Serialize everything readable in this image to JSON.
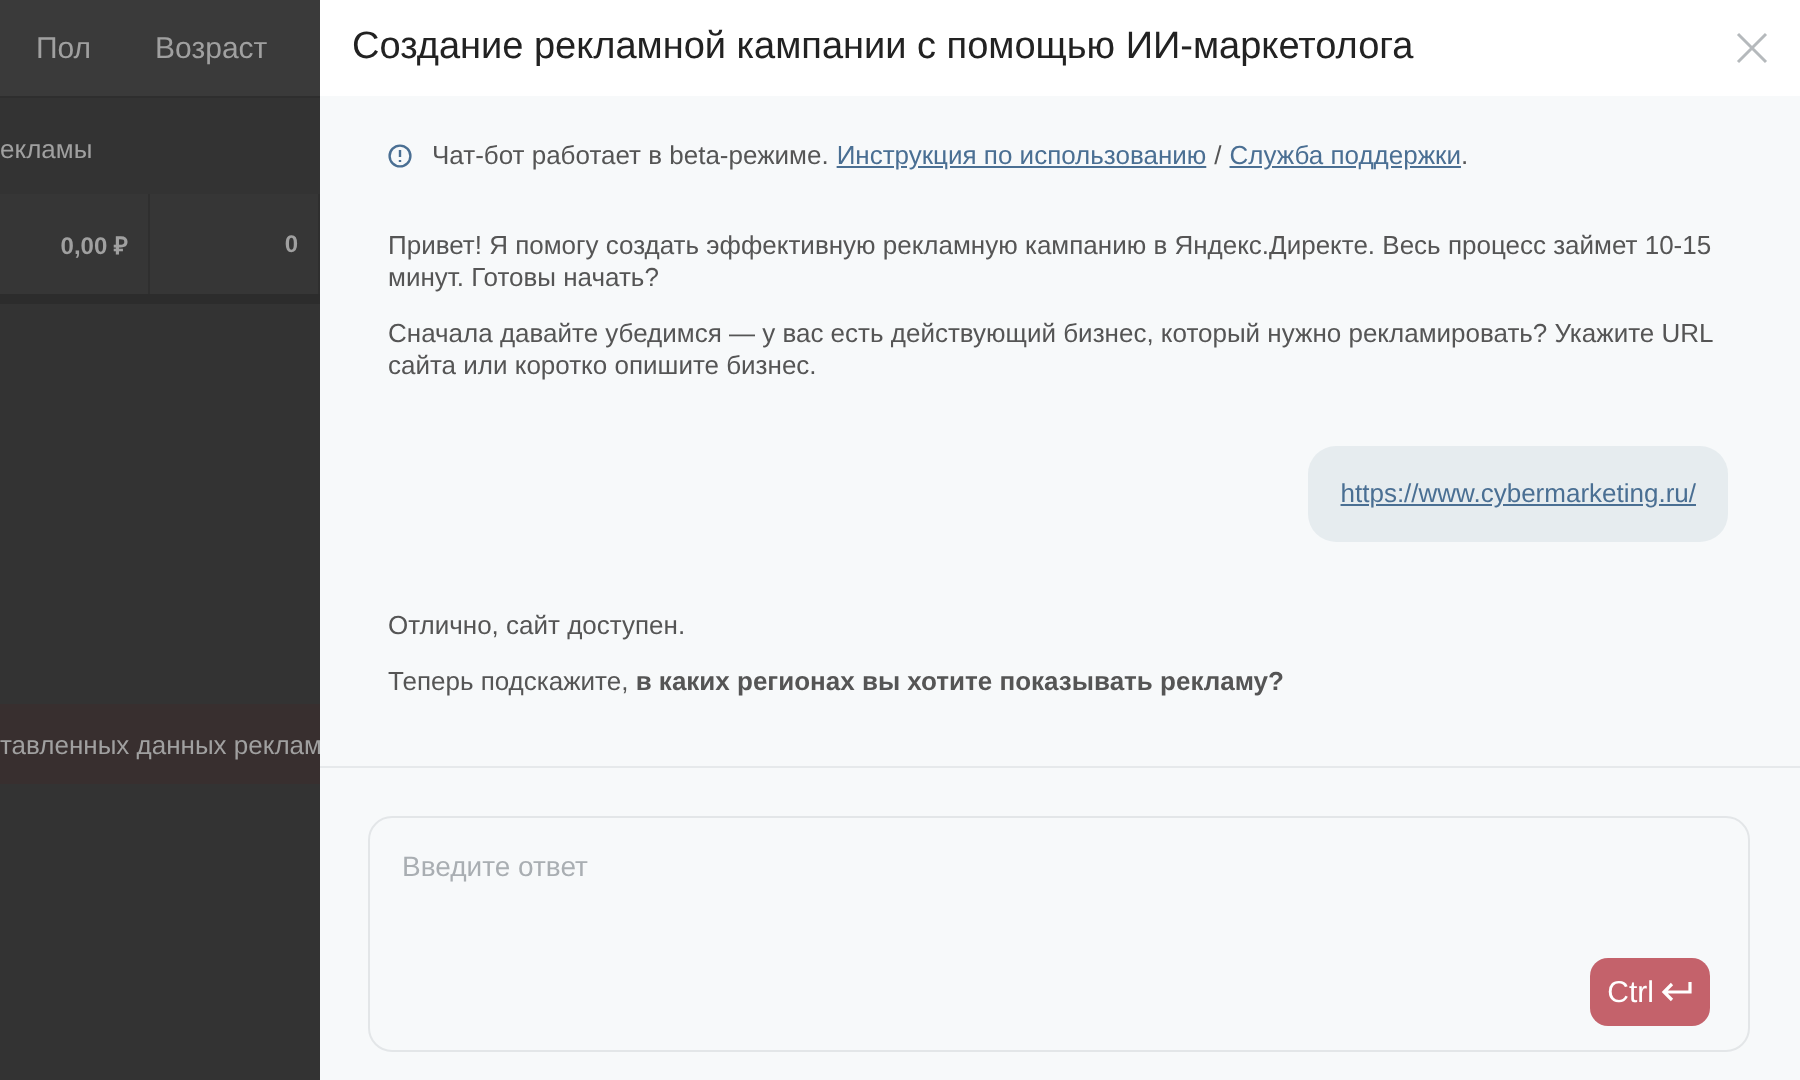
{
  "background": {
    "columns": [
      "Пол",
      "Возраст"
    ],
    "section_label": "екламы",
    "cells": [
      "0,00 ₽",
      "0"
    ],
    "notice": "тавленных данных реклам"
  },
  "modal": {
    "title": "Создание рекламной кампании с помощью ИИ-маркетолога",
    "beta_notice": {
      "text": "Чат-бот работает в beta-режиме.",
      "links": [
        "Инструкция по использованию",
        "Служба поддержки"
      ],
      "separator": "/",
      "end": "."
    },
    "messages": [
      {
        "kind": "bot",
        "paragraphs": [
          "Привет! Я помогу создать эффективную рекламную кампанию в Яндекс.Директе. Весь процесс займет 10-15 минут. Готовы начать?",
          "Сначала давайте убедимся — у вас есть действующий бизнес, который нужно рекламировать? Укажите URL сайта или коротко опишите бизнес."
        ]
      },
      {
        "kind": "user",
        "link": "https://www.cybermarketing.ru/"
      },
      {
        "kind": "bot",
        "paragraphs": [
          "Отлично, сайт доступен.",
          "Теперь подскажите, **в каких регионах вы хотите показывать рекламу?**"
        ]
      }
    ],
    "input": {
      "placeholder": "Введите ответ"
    },
    "send_button": {
      "label": "Ctrl"
    }
  }
}
